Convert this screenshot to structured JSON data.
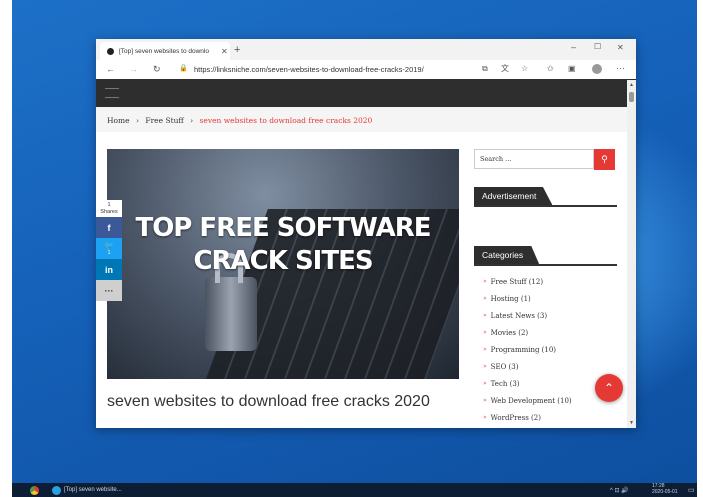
{
  "browser": {
    "tab_title": "[Top] seven websites to downlo",
    "url": "https://linksniche.com/seven-websites-to-download-free-cracks-2019/"
  },
  "breadcrumb": {
    "home": "Home",
    "category": "Free Stuff",
    "current": "seven websites to download free cracks 2020"
  },
  "hero": {
    "line1": "TOP FREE SOFTWARE",
    "line2": "CRACK SITES"
  },
  "share": {
    "count": "1",
    "label": "Shares",
    "twitter_count": "1"
  },
  "post": {
    "title": "seven websites to download free cracks 2020"
  },
  "sidebar": {
    "search_placeholder": "Search ...",
    "advertisement_title": "Advertisement",
    "categories_title": "Categories",
    "categories": [
      {
        "label": "Free Stuff (12)"
      },
      {
        "label": "Hosting (1)"
      },
      {
        "label": "Latest News (3)"
      },
      {
        "label": "Movies (2)"
      },
      {
        "label": "Programming (10)"
      },
      {
        "label": "SEO (3)"
      },
      {
        "label": "Tech (3)"
      },
      {
        "label": "Web Development (10)"
      },
      {
        "label": "WordPress (2)"
      }
    ]
  },
  "taskbar": {
    "window_label": "[Top] seven website...",
    "time": "17:28",
    "date": "2020-05-01"
  },
  "colors": {
    "accent": "#e53935",
    "facebook": "#3b5998",
    "twitter": "#1da1f2",
    "linkedin": "#0077b5",
    "nav_dark": "#2e2e2e"
  }
}
